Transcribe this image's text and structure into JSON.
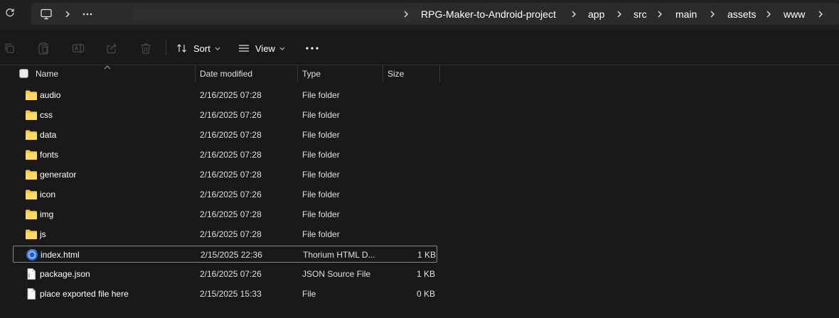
{
  "address_bar": {
    "path": [
      "RPG-Maker-to-Android-project",
      "app",
      "src",
      "main",
      "assets",
      "www"
    ]
  },
  "toolbar": {
    "sort_label": "Sort",
    "view_label": "View"
  },
  "columns": {
    "name": "Name",
    "date": "Date modified",
    "type": "Type",
    "size": "Size"
  },
  "files": [
    {
      "name": "audio",
      "date": "2/16/2025 07:28",
      "type": "File folder",
      "size": "",
      "icon": "folder-icon"
    },
    {
      "name": "css",
      "date": "2/16/2025 07:26",
      "type": "File folder",
      "size": "",
      "icon": "folder-icon"
    },
    {
      "name": "data",
      "date": "2/16/2025 07:28",
      "type": "File folder",
      "size": "",
      "icon": "folder-icon"
    },
    {
      "name": "fonts",
      "date": "2/16/2025 07:28",
      "type": "File folder",
      "size": "",
      "icon": "folder-icon"
    },
    {
      "name": "generator",
      "date": "2/16/2025 07:28",
      "type": "File folder",
      "size": "",
      "icon": "folder-icon"
    },
    {
      "name": "icon",
      "date": "2/16/2025 07:26",
      "type": "File folder",
      "size": "",
      "icon": "folder-icon"
    },
    {
      "name": "img",
      "date": "2/16/2025 07:28",
      "type": "File folder",
      "size": "",
      "icon": "folder-icon"
    },
    {
      "name": "js",
      "date": "2/16/2025 07:28",
      "type": "File folder",
      "size": "",
      "icon": "folder-icon"
    },
    {
      "name": "index.html",
      "date": "2/15/2025 22:36",
      "type": "Thorium HTML D...",
      "size": "1 KB",
      "icon": "browser-html-icon",
      "selected": true
    },
    {
      "name": "package.json",
      "date": "2/16/2025 07:26",
      "type": "JSON Source File",
      "size": "1 KB",
      "icon": "json-file-icon"
    },
    {
      "name": "place exported file here",
      "date": "2/15/2025 15:33",
      "type": "File",
      "size": "0 KB",
      "icon": "file-icon"
    }
  ],
  "colors": {
    "background": "#191919",
    "folder": "#f2c74a",
    "selection_border": "#8a8a8a"
  }
}
